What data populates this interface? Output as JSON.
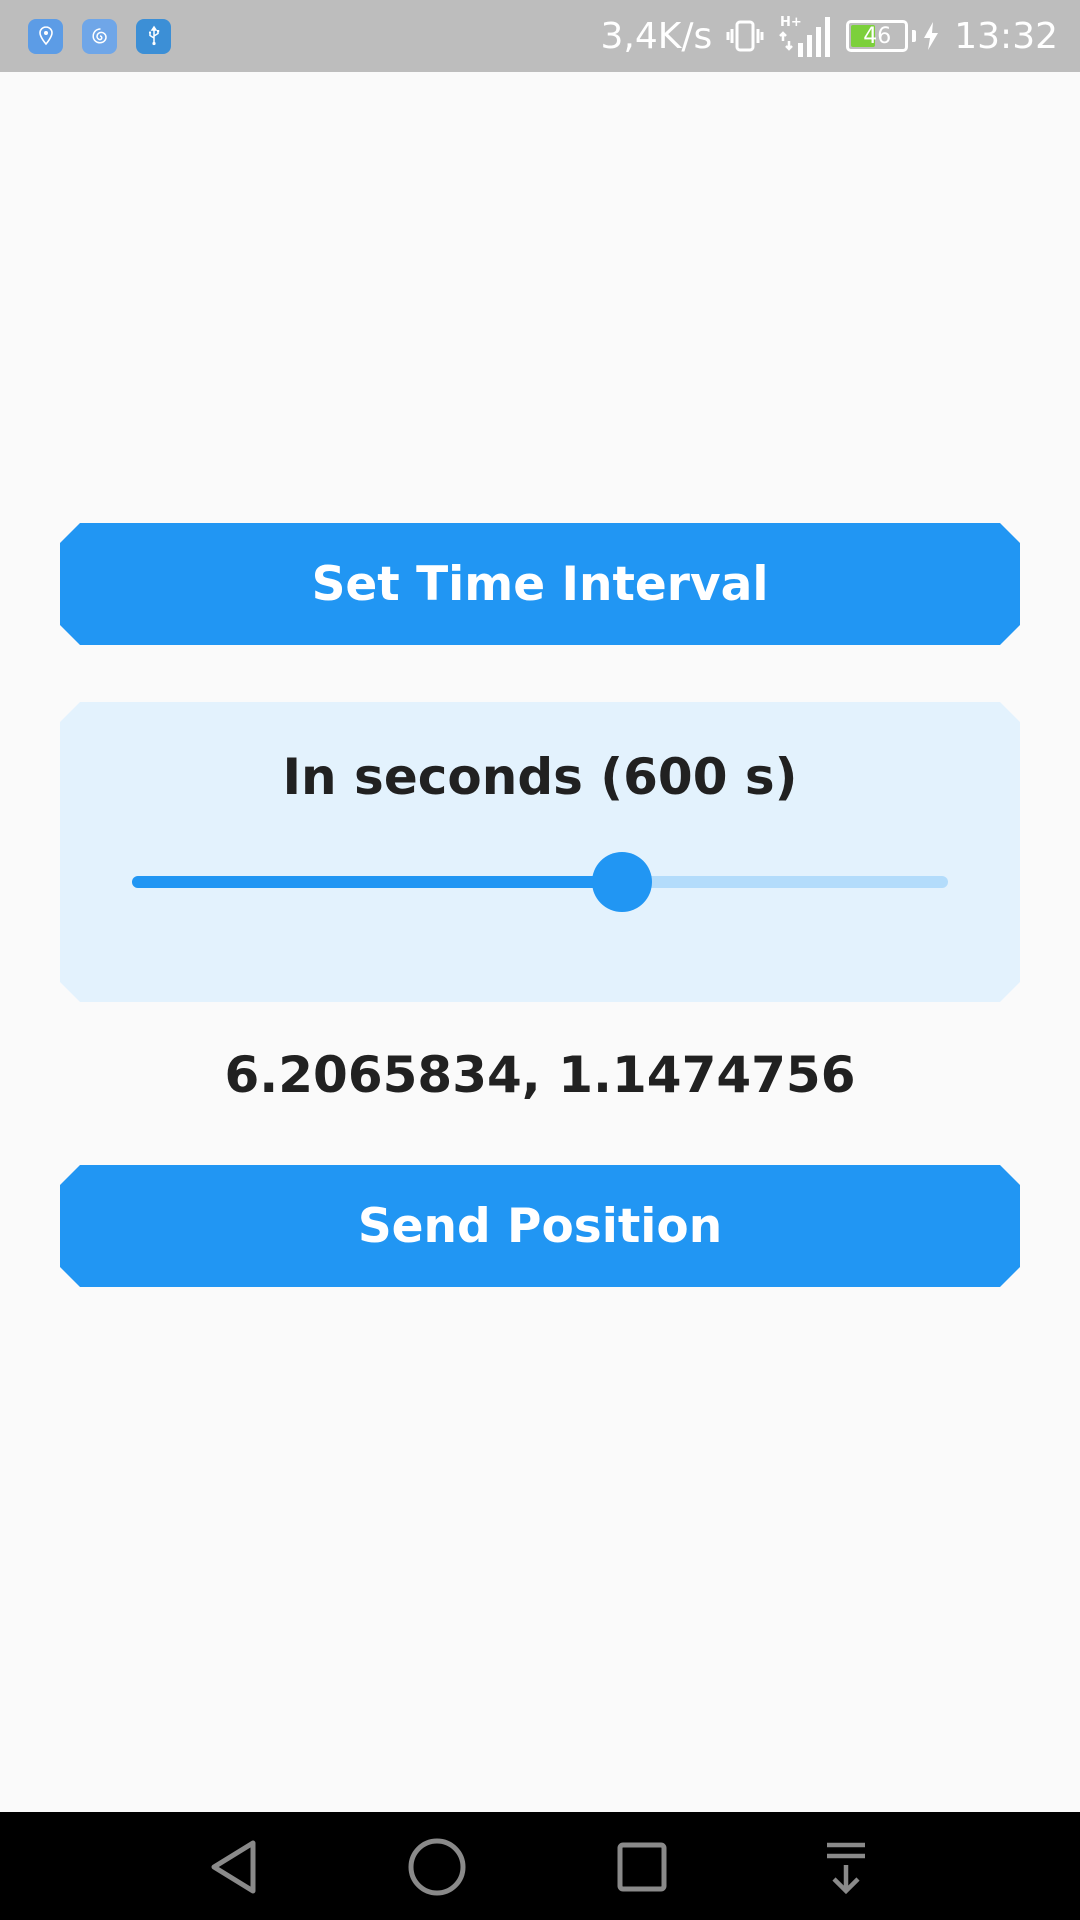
{
  "status_bar": {
    "notification_icons": [
      "location-icon",
      "spiral-app-icon",
      "usb-icon"
    ],
    "net_speed": "3,4K/s",
    "network_type": "H+",
    "battery_level": "46",
    "battery_fraction": 0.46,
    "time": "13:32",
    "colors": {
      "background": "#bdbdbd",
      "location_icon_bg": "#5c9ce6",
      "spiral_icon_bg": "#6fa6e8",
      "usb_icon_bg": "#3c8fd6",
      "battery_fill": "#7cd03b"
    }
  },
  "main": {
    "set_interval_button": {
      "label": "Set Time Interval"
    },
    "slider_card": {
      "label": "In seconds (600 s)",
      "slider_fraction": 0.6
    },
    "coordinates": "6.2065834, 1.1474756",
    "send_position_button": {
      "label": "Send Position"
    },
    "colors": {
      "accent": "#2196f3",
      "card_background": "#e3f2fd",
      "slider_inactive": "#b3dcfb",
      "text": "#212121",
      "page_background": "#fafafa"
    }
  },
  "nav_bar": {
    "buttons": [
      "back-icon",
      "home-icon",
      "recents-icon",
      "notification-pull-down-icon"
    ]
  }
}
